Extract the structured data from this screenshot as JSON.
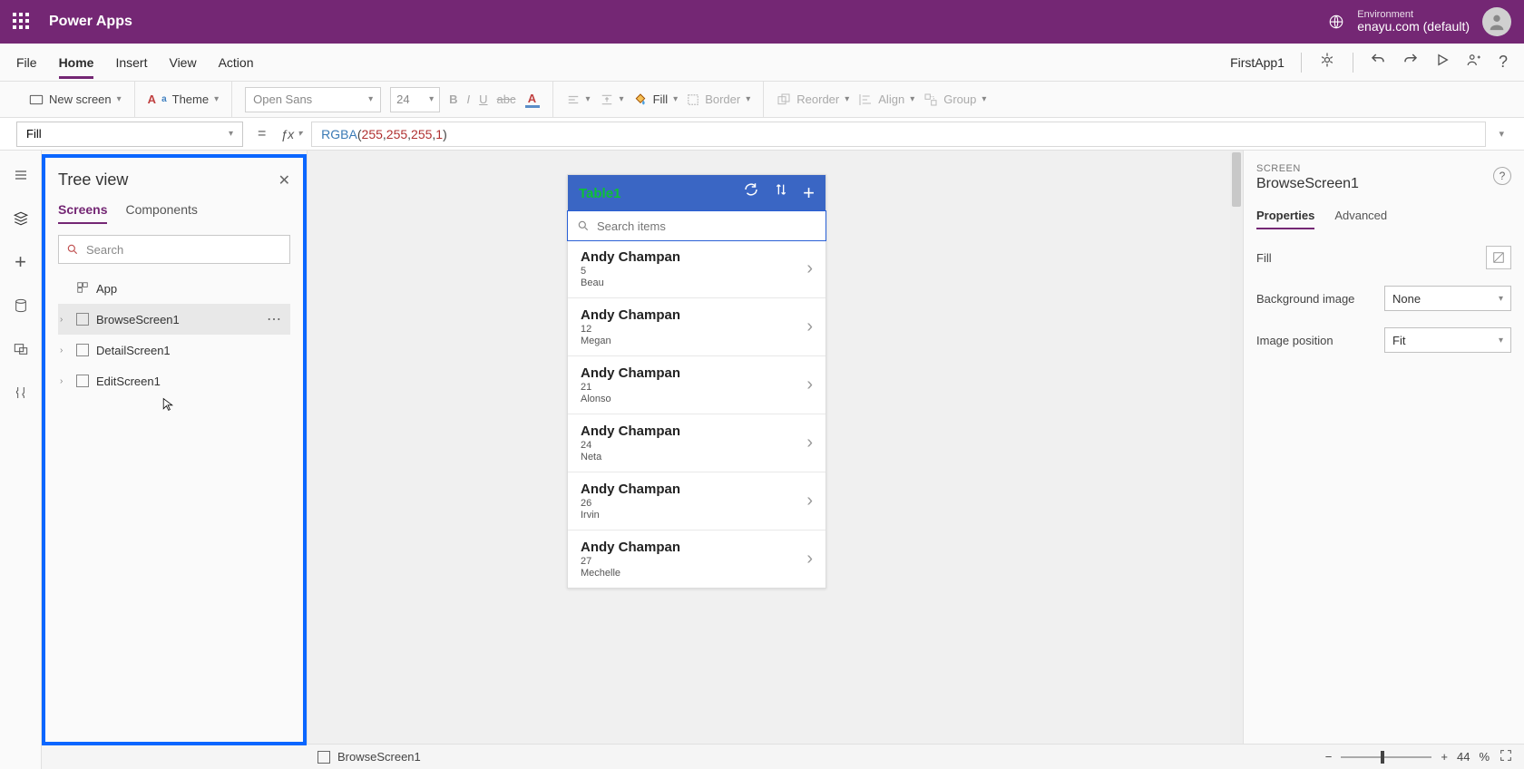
{
  "topbar": {
    "product": "Power Apps",
    "env_label": "Environment",
    "env_name": "enayu.com (default)"
  },
  "menu": {
    "items": [
      "File",
      "Home",
      "Insert",
      "View",
      "Action"
    ],
    "active": "Home",
    "app_name": "FirstApp1"
  },
  "ribbon": {
    "new_screen": "New screen",
    "theme": "Theme",
    "font": "Open Sans",
    "font_size": "24",
    "fill": "Fill",
    "border": "Border",
    "reorder": "Reorder",
    "align": "Align",
    "group": "Group"
  },
  "formula": {
    "prop": "Fill",
    "fn": "RGBA",
    "args": [
      "255",
      "255",
      "255",
      "1"
    ]
  },
  "tree": {
    "title": "Tree view",
    "tabs": [
      "Screens",
      "Components"
    ],
    "active_tab": "Screens",
    "search_placeholder": "Search",
    "app_label": "App",
    "selected": "BrowseScreen1",
    "items": [
      {
        "name": "BrowseScreen1"
      },
      {
        "name": "DetailScreen1"
      },
      {
        "name": "EditScreen1"
      }
    ]
  },
  "phone": {
    "title": "Table1",
    "search_ph": "Search items",
    "rows": [
      {
        "name": "Andy Champan",
        "v": "5",
        "sub": "Beau"
      },
      {
        "name": "Andy Champan",
        "v": "12",
        "sub": "Megan"
      },
      {
        "name": "Andy Champan",
        "v": "21",
        "sub": "Alonso"
      },
      {
        "name": "Andy Champan",
        "v": "24",
        "sub": "Neta"
      },
      {
        "name": "Andy Champan",
        "v": "26",
        "sub": "Irvin"
      },
      {
        "name": "Andy Champan",
        "v": "27",
        "sub": "Mechelle"
      }
    ]
  },
  "props": {
    "type": "SCREEN",
    "name": "BrowseScreen1",
    "tabs": [
      "Properties",
      "Advanced"
    ],
    "active_tab": "Properties",
    "rows": {
      "fill_label": "Fill",
      "bg_label": "Background image",
      "bg_value": "None",
      "pos_label": "Image position",
      "pos_value": "Fit"
    }
  },
  "status": {
    "screen": "BrowseScreen1",
    "zoom_value": "44",
    "zoom_pct": "%"
  }
}
